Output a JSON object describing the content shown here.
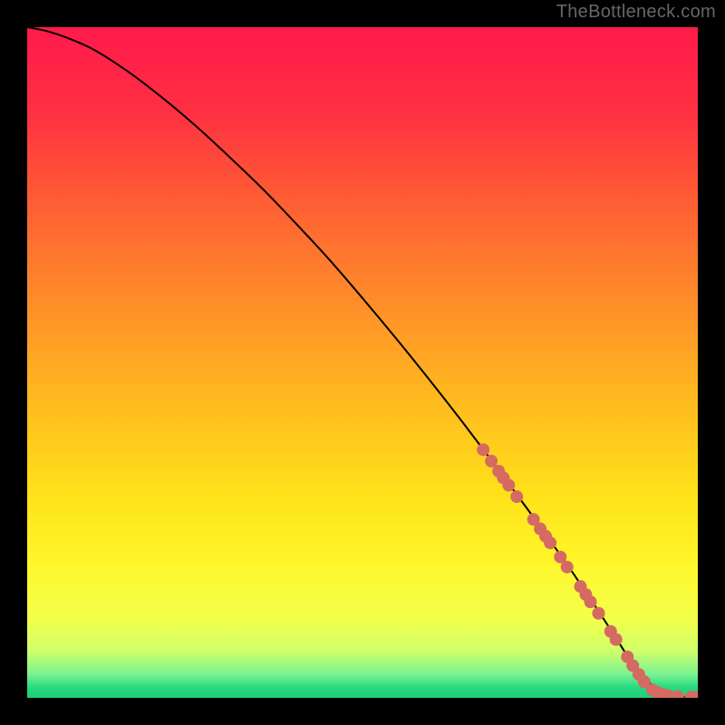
{
  "watermark": "TheBottleneck.com",
  "chart_data": {
    "type": "line",
    "title": "",
    "xlabel": "",
    "ylabel": "",
    "xlim": [
      0,
      100
    ],
    "ylim": [
      0,
      100
    ],
    "grid": false,
    "legend": false,
    "background_gradient": {
      "stops": [
        {
          "offset": 0.0,
          "color": "#ff1a4b"
        },
        {
          "offset": 0.12,
          "color": "#ff2e43"
        },
        {
          "offset": 0.25,
          "color": "#ff5a34"
        },
        {
          "offset": 0.4,
          "color": "#ff8a2a"
        },
        {
          "offset": 0.55,
          "color": "#ffb81f"
        },
        {
          "offset": 0.7,
          "color": "#ffe21a"
        },
        {
          "offset": 0.8,
          "color": "#fff72b"
        },
        {
          "offset": 0.88,
          "color": "#f4ff4a"
        },
        {
          "offset": 0.93,
          "color": "#cfff6a"
        },
        {
          "offset": 0.965,
          "color": "#7af292"
        },
        {
          "offset": 0.985,
          "color": "#26d97f"
        },
        {
          "offset": 1.0,
          "color": "#1fcf78"
        }
      ]
    },
    "series": [
      {
        "name": "curve",
        "color": "#000000",
        "stroke_width": 2,
        "x": [
          0,
          3,
          6,
          10,
          15,
          20,
          25,
          30,
          35,
          40,
          45,
          50,
          55,
          60,
          65,
          70,
          75,
          80,
          82,
          84,
          86,
          88,
          90,
          92,
          94,
          96,
          98,
          100
        ],
        "y": [
          100,
          99.4,
          98.4,
          96.6,
          93.4,
          89.6,
          85.4,
          80.8,
          76.0,
          70.8,
          65.4,
          59.6,
          53.6,
          47.4,
          41.0,
          34.4,
          27.6,
          20.6,
          17.7,
          14.7,
          11.7,
          8.6,
          5.5,
          3.0,
          1.3,
          0.4,
          0.1,
          0.1
        ]
      }
    ],
    "scatter": {
      "name": "dots",
      "color": "#d56a62",
      "radius": 7,
      "points": [
        {
          "x": 68.0,
          "y": 37.0
        },
        {
          "x": 69.2,
          "y": 35.3
        },
        {
          "x": 70.3,
          "y": 33.8
        },
        {
          "x": 71.0,
          "y": 32.8
        },
        {
          "x": 71.8,
          "y": 31.7
        },
        {
          "x": 73.0,
          "y": 30.0
        },
        {
          "x": 75.5,
          "y": 26.6
        },
        {
          "x": 76.5,
          "y": 25.2
        },
        {
          "x": 77.3,
          "y": 24.1
        },
        {
          "x": 78.0,
          "y": 23.1
        },
        {
          "x": 79.5,
          "y": 21.0
        },
        {
          "x": 80.5,
          "y": 19.5
        },
        {
          "x": 82.5,
          "y": 16.6
        },
        {
          "x": 83.3,
          "y": 15.4
        },
        {
          "x": 84.0,
          "y": 14.3
        },
        {
          "x": 85.2,
          "y": 12.6
        },
        {
          "x": 87.0,
          "y": 9.9
        },
        {
          "x": 87.8,
          "y": 8.7
        },
        {
          "x": 89.5,
          "y": 6.1
        },
        {
          "x": 90.3,
          "y": 4.8
        },
        {
          "x": 91.2,
          "y": 3.5
        },
        {
          "x": 92.0,
          "y": 2.4
        },
        {
          "x": 93.2,
          "y": 1.2
        },
        {
          "x": 94.0,
          "y": 0.8
        },
        {
          "x": 94.8,
          "y": 0.5
        },
        {
          "x": 95.6,
          "y": 0.3
        },
        {
          "x": 97.0,
          "y": 0.2
        },
        {
          "x": 99.0,
          "y": 0.1
        },
        {
          "x": 100.0,
          "y": 0.1
        }
      ]
    }
  }
}
